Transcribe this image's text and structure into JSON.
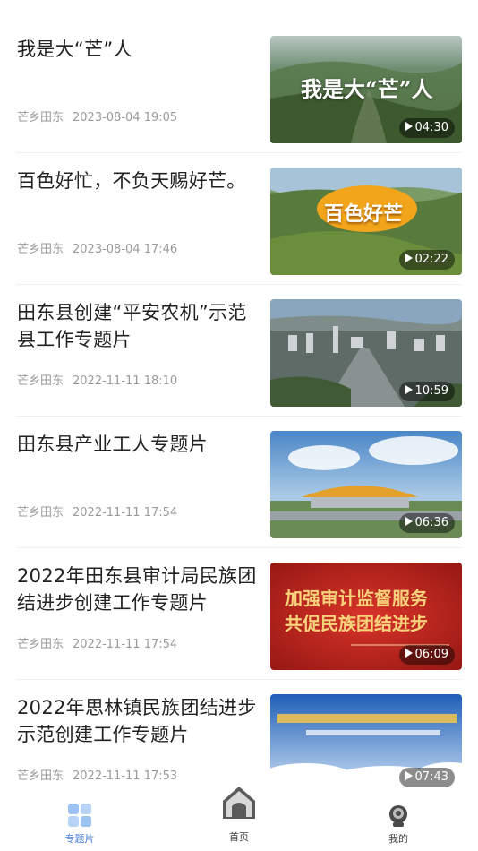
{
  "feed": {
    "items": [
      {
        "title": "我是大“芒”人",
        "source": "芒乡田东",
        "date": "2023-08-04 19:05",
        "duration": "04:30",
        "thumb_text": "我是大“芒”人"
      },
      {
        "title": "百色好忙，不负天赐好芒。",
        "source": "芒乡田东",
        "date": "2023-08-04 17:46",
        "duration": "02:22",
        "thumb_text": "百色好芒"
      },
      {
        "title": "田东县创建“平安农机”示范县工作专题片",
        "source": "芒乡田东",
        "date": "2022-11-11 18:10",
        "duration": "10:59"
      },
      {
        "title": "田东县产业工人专题片",
        "source": "芒乡田东",
        "date": "2022-11-11 17:54",
        "duration": "06:36"
      },
      {
        "title": "2022年田东县审计局民族团结进步创建工作专题片",
        "source": "芒乡田东",
        "date": "2022-11-11 17:54",
        "duration": "06:09",
        "thumb_text_1": "加强审计监督服务",
        "thumb_text_2": "共促民族团结进步"
      },
      {
        "title": "2022年思林镇民族团结进步示范创建工作专题片",
        "source": "芒乡田东",
        "date": "2022-11-11 17:53",
        "duration": "07:43"
      }
    ]
  },
  "tabbar": {
    "tabs": [
      {
        "label": "专题片",
        "icon": "feature-videos-icon",
        "active": true
      },
      {
        "label": "首页",
        "icon": "home-icon",
        "active": false
      },
      {
        "label": "我的",
        "icon": "profile-icon",
        "active": false
      }
    ],
    "active_color": "#4a7fdc"
  }
}
